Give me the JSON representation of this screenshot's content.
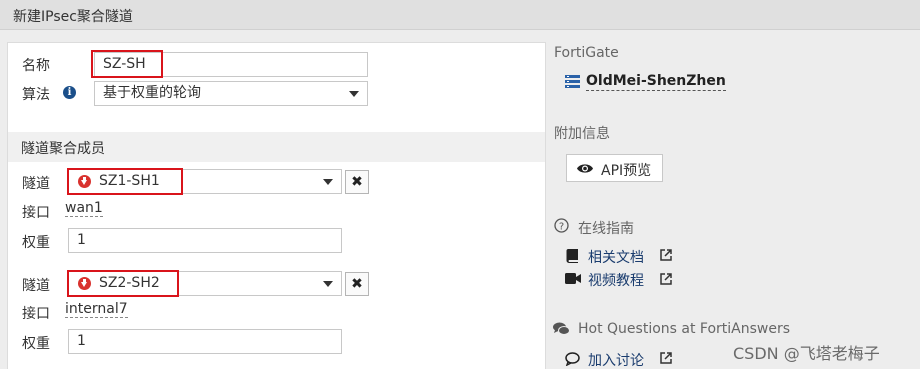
{
  "window_title": "新建IPsec聚合隧道",
  "form": {
    "name_label": "名称",
    "name_value": "SZ-SH",
    "algorithm_label": "算法",
    "algorithm_value": "基于权重的轮询"
  },
  "members_section": {
    "header": "隧道聚合成员",
    "members": [
      {
        "tunnel_label": "隧道",
        "tunnel_value": "SZ1-SH1",
        "interface_label": "接口",
        "interface_value": "wan1",
        "weight_label": "权重",
        "weight_value": "1",
        "remove_symbol": "✖"
      },
      {
        "tunnel_label": "隧道",
        "tunnel_value": "SZ2-SH2",
        "interface_label": "接口",
        "interface_value": "internal7",
        "weight_label": "权重",
        "weight_value": "1",
        "remove_symbol": "✖"
      }
    ]
  },
  "sidebar": {
    "fortigate_label": "FortiGate",
    "device_name": "OldMei-ShenZhen",
    "additional_info_label": "附加信息",
    "api_preview_label": "API预览",
    "online_guide_label": "在线指南",
    "docs_link": "相关文档",
    "video_link": "视频教程",
    "hot_questions_label": "Hot Questions at FortiAnswers",
    "join_discussion_link": "加入讨论"
  },
  "watermark": "CSDN @飞塔老梅子",
  "colors": {
    "highlight_border": "#d9141b",
    "status_down": "#d9322e",
    "link": "#1a3c6e"
  }
}
